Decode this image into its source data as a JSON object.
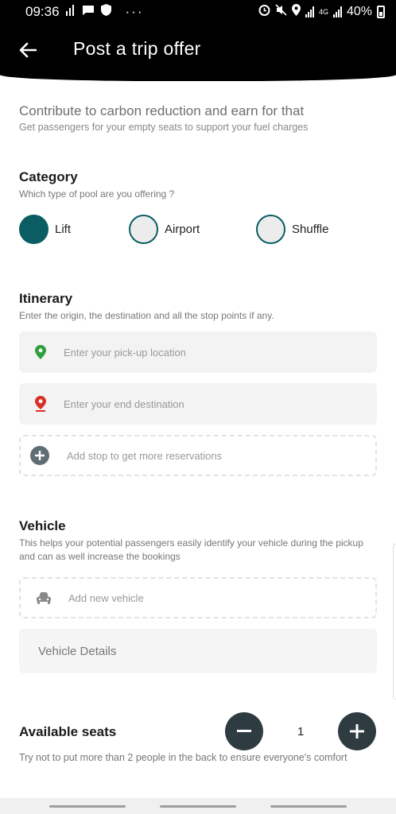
{
  "status_bar": {
    "time": "09:36",
    "network": "4G",
    "battery": "40%"
  },
  "app_bar": {
    "title": "Post a trip offer"
  },
  "intro": {
    "title": "Contribute to carbon reduction and earn for that",
    "subtitle": "Get passengers for your empty seats to support your fuel charges"
  },
  "category": {
    "title": "Category",
    "subtitle": "Which type of pool are you offering ?",
    "options": [
      {
        "label": "Lift",
        "selected": true
      },
      {
        "label": "Airport",
        "selected": false
      },
      {
        "label": "Shuffle",
        "selected": false
      }
    ]
  },
  "itinerary": {
    "title": "Itinerary",
    "subtitle": "Enter the origin, the destination and all the stop points if any.",
    "pickup_placeholder": "Enter your pick-up location",
    "destination_placeholder": "Enter your end destination",
    "add_stop_label": "Add stop to get more reservations"
  },
  "vehicle": {
    "title": "Vehicle",
    "subtitle": "This helps your potential passengers easily identify your vehicle during the pickup and can as well increase the bookings",
    "add_vehicle_label": "Add new vehicle",
    "details_label": "Vehicle Details"
  },
  "seats": {
    "title": "Available seats",
    "count": "1",
    "hint": "Try not to put more than 2 people in the back to ensure everyone's comfort"
  },
  "colors": {
    "accent": "#0a5e63",
    "seat_button": "#2e3b41",
    "pickup_pin": "#2e9e3e",
    "destination_pin": "#d93025"
  },
  "icons": {
    "back": "arrow-left-icon",
    "pickup": "location-pin-icon",
    "destination": "location-pin-icon",
    "add_stop": "plus-circle-icon",
    "vehicle": "car-icon",
    "minus": "minus-icon",
    "plus": "plus-icon"
  }
}
